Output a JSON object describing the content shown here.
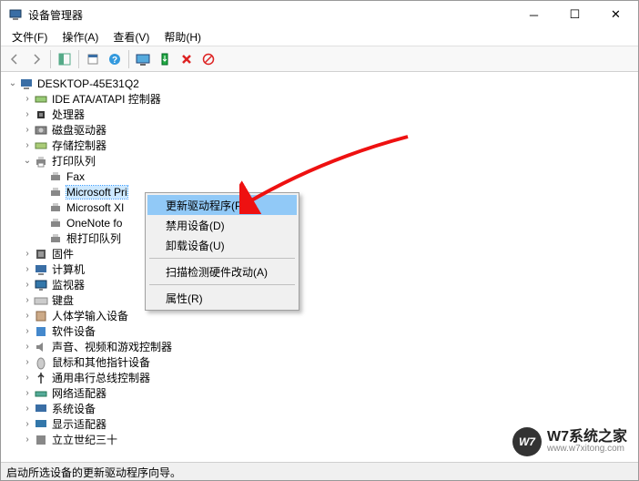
{
  "window": {
    "title": "设备管理器"
  },
  "menu": {
    "file": "文件(F)",
    "action": "操作(A)",
    "view": "查看(V)",
    "help": "帮助(H)"
  },
  "tree": {
    "root": "DESKTOP-45E31Q2",
    "ide": "IDE ATA/ATAPI 控制器",
    "cpu": "处理器",
    "disk": "磁盘驱动器",
    "storage": "存储控制器",
    "printq": "打印队列",
    "fax": "Fax",
    "msprint": "Microsoft Pri",
    "msxps": "Microsoft XI",
    "onenote": "OneNote fo",
    "rootprint": "根打印队列",
    "firmware": "固件",
    "computer": "计算机",
    "monitor": "监视器",
    "keyboard": "键盘",
    "hid": "人体学输入设备",
    "software": "软件设备",
    "sound": "声音、视频和游戏控制器",
    "mouse": "鼠标和其他指针设备",
    "usb": "通用串行总线控制器",
    "network": "网络适配器",
    "system": "系统设备",
    "display": "显示适配器",
    "last": "立立世纪三十"
  },
  "context": {
    "update": "更新驱动程序(P)",
    "disable": "禁用设备(D)",
    "uninstall": "卸载设备(U)",
    "scan": "扫描检测硬件改动(A)",
    "properties": "属性(R)"
  },
  "status": {
    "text": "启动所选设备的更新驱动程序向导。"
  },
  "watermark": {
    "logo": "W7",
    "main": "W7系统之家",
    "sub": "www.w7xitong.com"
  }
}
